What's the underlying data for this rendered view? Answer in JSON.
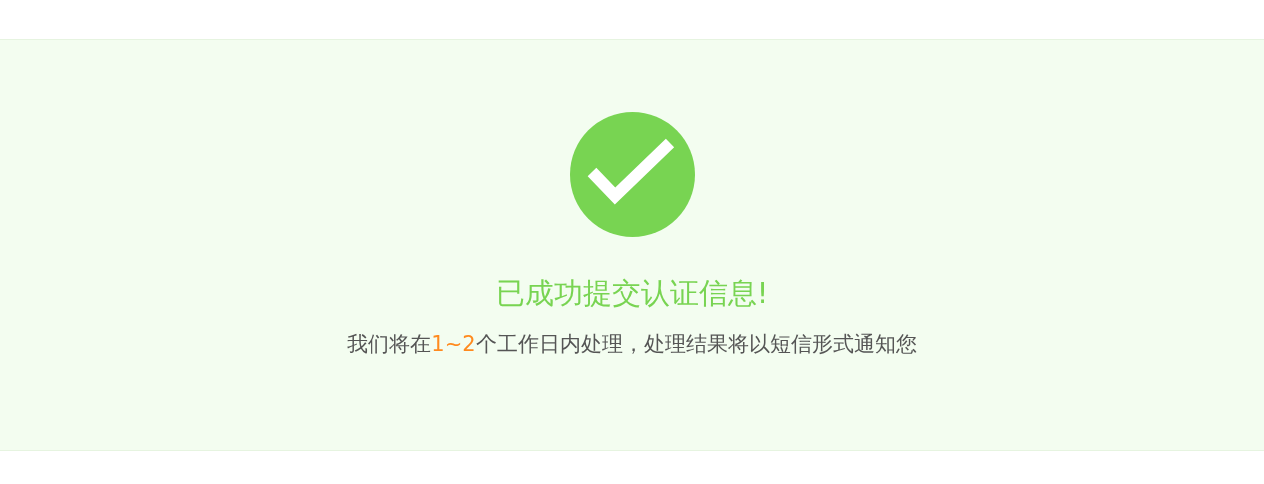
{
  "result": {
    "success": true,
    "title": "已成功提交认证信息!",
    "message": {
      "before": "我们将在",
      "highlight": "1~2",
      "after": "个工作日内处理，处理结果将以短信形式通知您"
    }
  }
}
